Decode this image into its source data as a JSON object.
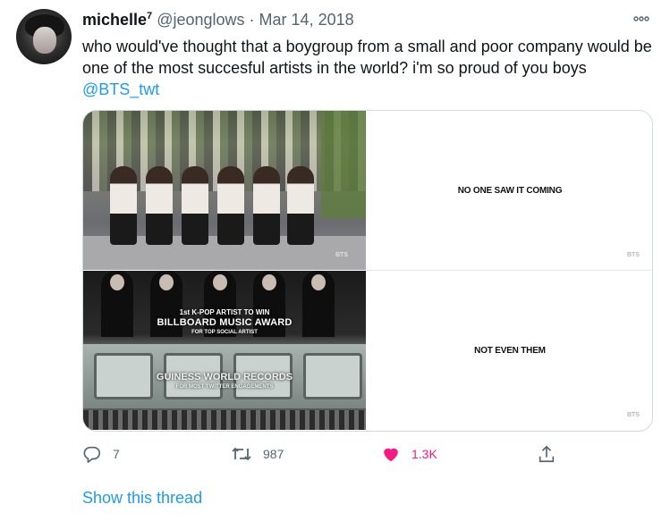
{
  "tweet": {
    "author": {
      "name": "michelle",
      "superscript": "7",
      "handle": "@jeonglows"
    },
    "separator": "·",
    "date": "Mar 14, 2018",
    "more_icon": "more-icon",
    "text": "who would've thought that a boygroup from a small and poor company would be one of the most succesful artists in the world? i'm so proud of you boys ",
    "mention": "@BTS_twt"
  },
  "media": {
    "panel1": {
      "watermark": "BTS"
    },
    "panel2": {
      "caption_top": "1st K-POP ARTIST TO WIN",
      "caption_main": "BILLBOARD MUSIC AWARD",
      "caption_sub": "FOR TOP SOCIAL ARTIST",
      "caption2_main": "GUINESS WORLD RECORDS",
      "caption2_sub": "FOR MOST TWITTER ENGAGEMENTS"
    },
    "panel3": {
      "text": "NO ONE SAW IT COMING",
      "watermark": "BTS"
    },
    "panel4": {
      "text": "NOT EVEN THEM",
      "watermark": "BTS"
    }
  },
  "actions": {
    "reply": {
      "icon": "reply-icon",
      "count": "7"
    },
    "retweet": {
      "icon": "retweet-icon",
      "count": "987"
    },
    "like": {
      "icon": "heart-icon",
      "count": "1.3K",
      "color": "#f91880"
    },
    "share": {
      "icon": "share-icon"
    }
  },
  "show_thread": "Show this thread",
  "colors": {
    "link": "#1d9bf0",
    "secondary_text": "#536471",
    "primary_text": "#0f1419"
  }
}
